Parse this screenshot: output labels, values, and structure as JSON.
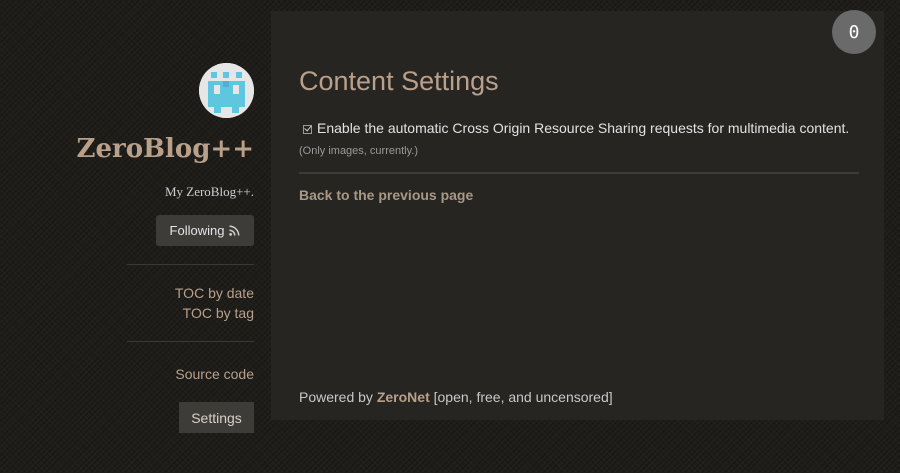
{
  "sidebar": {
    "blog_title": "ZeroBlog++",
    "blog_description": "My ZeroBlog++.",
    "follow_label": "Following",
    "links_group1": [
      {
        "label": "TOC by date"
      },
      {
        "label": "TOC by tag"
      }
    ],
    "source_code_label": "Source code",
    "settings_label": "Settings"
  },
  "notification_count": "0",
  "main": {
    "title": "Content Settings",
    "option": {
      "checked": true,
      "label": "Enable the automatic Cross Origin Resource Sharing requests for multimedia content.",
      "note": "(Only images, currently.)"
    },
    "back_link": "Back to the previous page"
  },
  "footer": {
    "prefix": "Powered by",
    "brand": "ZeroNet",
    "suffix": "[open, free, and uncensored]"
  },
  "colors": {
    "accent": "#b8a08a",
    "background": "#1e1d1a",
    "panel": "#262522",
    "avatar": "#5fc6e0"
  }
}
